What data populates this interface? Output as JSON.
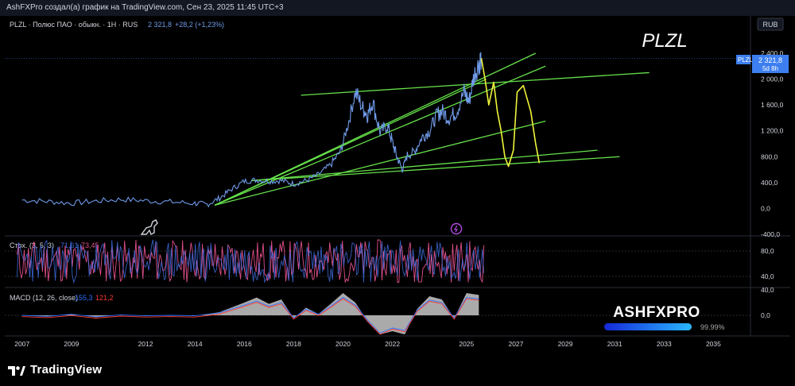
{
  "header": {
    "caption": "AshFXPro создал(а) график на TradingView.com, Сен 23, 2025 11:45 UTC+3"
  },
  "symbol_line": {
    "name": "PLZL · Полюс ПАО · обыкн. · 1H · RUS",
    "price": "2 321,8",
    "change": "+28,2 (+1,23%)"
  },
  "currency_label": "RUB",
  "watermark_title": "PLZL",
  "price_tag": {
    "ticker": "PLZL",
    "price": "2 321,8",
    "countdown": "5d 8h"
  },
  "stoch_legend": {
    "name": "Стох. (3, 5, 3)",
    "k": "71,61",
    "d": "73,45"
  },
  "macd_legend": {
    "name": "MACD (12, 26, close)",
    "macd": "155,3",
    "signal": "121,2"
  },
  "brand": {
    "name": "ASHFXPRO",
    "progress_label": "99.99%",
    "progress": 0.9999
  },
  "footer_logo": "TradingView",
  "colors": {
    "price_line": "#6f9ae8",
    "trend_line": "#66e04a",
    "forecast": "#f0f43a",
    "stoch_k": "#3f6de0",
    "stoch_d": "#e04f8a",
    "macd_hist": "#bdbdbd",
    "macd_line": "#2a6fff",
    "signal_line": "#ff3b30",
    "tag_bg": "#3d7ff0"
  },
  "chart_data": [
    {
      "type": "line",
      "ylim": [
        -400,
        2400
      ],
      "xlim": [
        2006.3,
        2036.5
      ],
      "y_ticks": [
        {
          "v": 2400,
          "label": "2 400,0"
        },
        {
          "v": 2000,
          "label": "2 000,0"
        },
        {
          "v": 1600,
          "label": "1 600,0"
        },
        {
          "v": 1200,
          "label": "1 200,0"
        },
        {
          "v": 800,
          "label": "800,0"
        },
        {
          "v": 400,
          "label": "400,0"
        },
        {
          "v": 0,
          "label": "0,0"
        },
        {
          "v": -400,
          "label": "-400,0"
        }
      ],
      "x_ticks": [
        "2007",
        "2009",
        "2012",
        "2014",
        "2016",
        "2018",
        "2020",
        "2022",
        "2025",
        "2027",
        "2029",
        "2031",
        "2033",
        "2035"
      ],
      "x_tick_values": [
        2007,
        2009,
        2012,
        2014,
        2016,
        2018,
        2020,
        2022,
        2025,
        2027,
        2029,
        2031,
        2033,
        2035
      ],
      "series": [
        {
          "values": [
            [
              2007,
              130
            ],
            [
              2008,
              110
            ],
            [
              2009,
              80
            ],
            [
              2010,
              115
            ],
            [
              2011,
              140
            ],
            [
              2012,
              120
            ],
            [
              2013,
              100
            ],
            [
              2014,
              80
            ],
            [
              2014.5,
              60
            ],
            [
              2015,
              160
            ],
            [
              2015.5,
              300
            ],
            [
              2016,
              420
            ],
            [
              2016.5,
              440
            ],
            [
              2017,
              420
            ],
            [
              2017.5,
              430
            ],
            [
              2018,
              380
            ],
            [
              2018.5,
              430
            ],
            [
              2019,
              520
            ],
            [
              2019.5,
              680
            ],
            [
              2019.9,
              880
            ],
            [
              2020.2,
              1300
            ],
            [
              2020.5,
              1800
            ],
            [
              2020.8,
              1550
            ],
            [
              2021,
              1450
            ],
            [
              2021.2,
              1650
            ],
            [
              2021.5,
              1180
            ],
            [
              2021.8,
              1280
            ],
            [
              2022,
              1020
            ],
            [
              2022.2,
              780
            ],
            [
              2022.4,
              600
            ],
            [
              2022.6,
              820
            ],
            [
              2022.9,
              880
            ],
            [
              2023.2,
              1100
            ],
            [
              2023.5,
              1200
            ],
            [
              2023.8,
              1450
            ],
            [
              2024,
              1500
            ],
            [
              2024.3,
              1400
            ],
            [
              2024.6,
              1500
            ],
            [
              2024.9,
              1800
            ],
            [
              2025.1,
              1650
            ],
            [
              2025.3,
              2050
            ],
            [
              2025.5,
              2250
            ],
            [
              2025.6,
              2321.8
            ]
          ]
        },
        {
          "values": [
            [
              2025.6,
              2321.8
            ],
            [
              2025.75,
              2000
            ],
            [
              2025.9,
              1600
            ],
            [
              2026.1,
              1950
            ],
            [
              2026.25,
              1500
            ],
            [
              2026.4,
              1200
            ],
            [
              2026.55,
              800
            ],
            [
              2026.7,
              650
            ],
            [
              2026.9,
              900
            ],
            [
              2027.05,
              1800
            ],
            [
              2027.3,
              1900
            ],
            [
              2027.6,
              1500
            ],
            [
              2027.8,
              1000
            ],
            [
              2027.95,
              700
            ]
          ]
        }
      ],
      "trendlines": [
        [
          [
            2014.8,
            50
          ],
          [
            2025.8,
            2000
          ]
        ],
        [
          [
            2014.8,
            50
          ],
          [
            2028.2,
            2200
          ]
        ],
        [
          [
            2014.8,
            50
          ],
          [
            2027.8,
            2400
          ]
        ],
        [
          [
            2014.8,
            50
          ],
          [
            2028.2,
            1350
          ]
        ],
        [
          [
            2016.3,
            430
          ],
          [
            2030.3,
            900
          ]
        ],
        [
          [
            2016.3,
            430
          ],
          [
            2031.2,
            800
          ]
        ],
        [
          [
            2018.3,
            1750
          ],
          [
            2032.4,
            2100
          ]
        ]
      ]
    },
    {
      "type": "line",
      "title": "Стох. (3, 5, 3)",
      "ylim": [
        25,
        100
      ],
      "y_ticks": [
        {
          "v": 80,
          "label": "80,0"
        },
        {
          "v": 40,
          "label": "40,0"
        }
      ],
      "xlim": [
        2006.3,
        2036.5
      ],
      "x_range": [
        2006.8,
        2025.7
      ],
      "series": [
        {
          "name": "K",
          "value": 71.61
        },
        {
          "name": "D",
          "value": 73.45
        }
      ]
    },
    {
      "type": "bar",
      "title": "MACD (12, 26, close)",
      "ylim": [
        -30,
        40
      ],
      "y_ticks": [
        {
          "v": 40,
          "label": "40,0"
        },
        {
          "v": 0,
          "label": "0,0"
        }
      ],
      "xlim": [
        2006.3,
        2036.5
      ],
      "x": [
        2007,
        2008,
        2009,
        2010,
        2011,
        2012,
        2013,
        2014,
        2015,
        2016,
        2016.5,
        2017,
        2017.5,
        2018,
        2018.5,
        2019,
        2019.5,
        2020,
        2020.5,
        2021,
        2021.5,
        2022,
        2022.5,
        2023,
        2023.5,
        2024,
        2024.5,
        2025,
        2025.5
      ],
      "values": [
        0,
        -2,
        2,
        -3,
        1,
        -1,
        0,
        -1,
        5,
        20,
        28,
        18,
        25,
        -5,
        12,
        2,
        18,
        35,
        20,
        -10,
        -35,
        -25,
        -30,
        10,
        30,
        25,
        -5,
        35,
        32
      ],
      "series": [
        {
          "name": "MACD",
          "value": 155.3
        },
        {
          "name": "Signal",
          "value": 121.2
        }
      ]
    }
  ]
}
